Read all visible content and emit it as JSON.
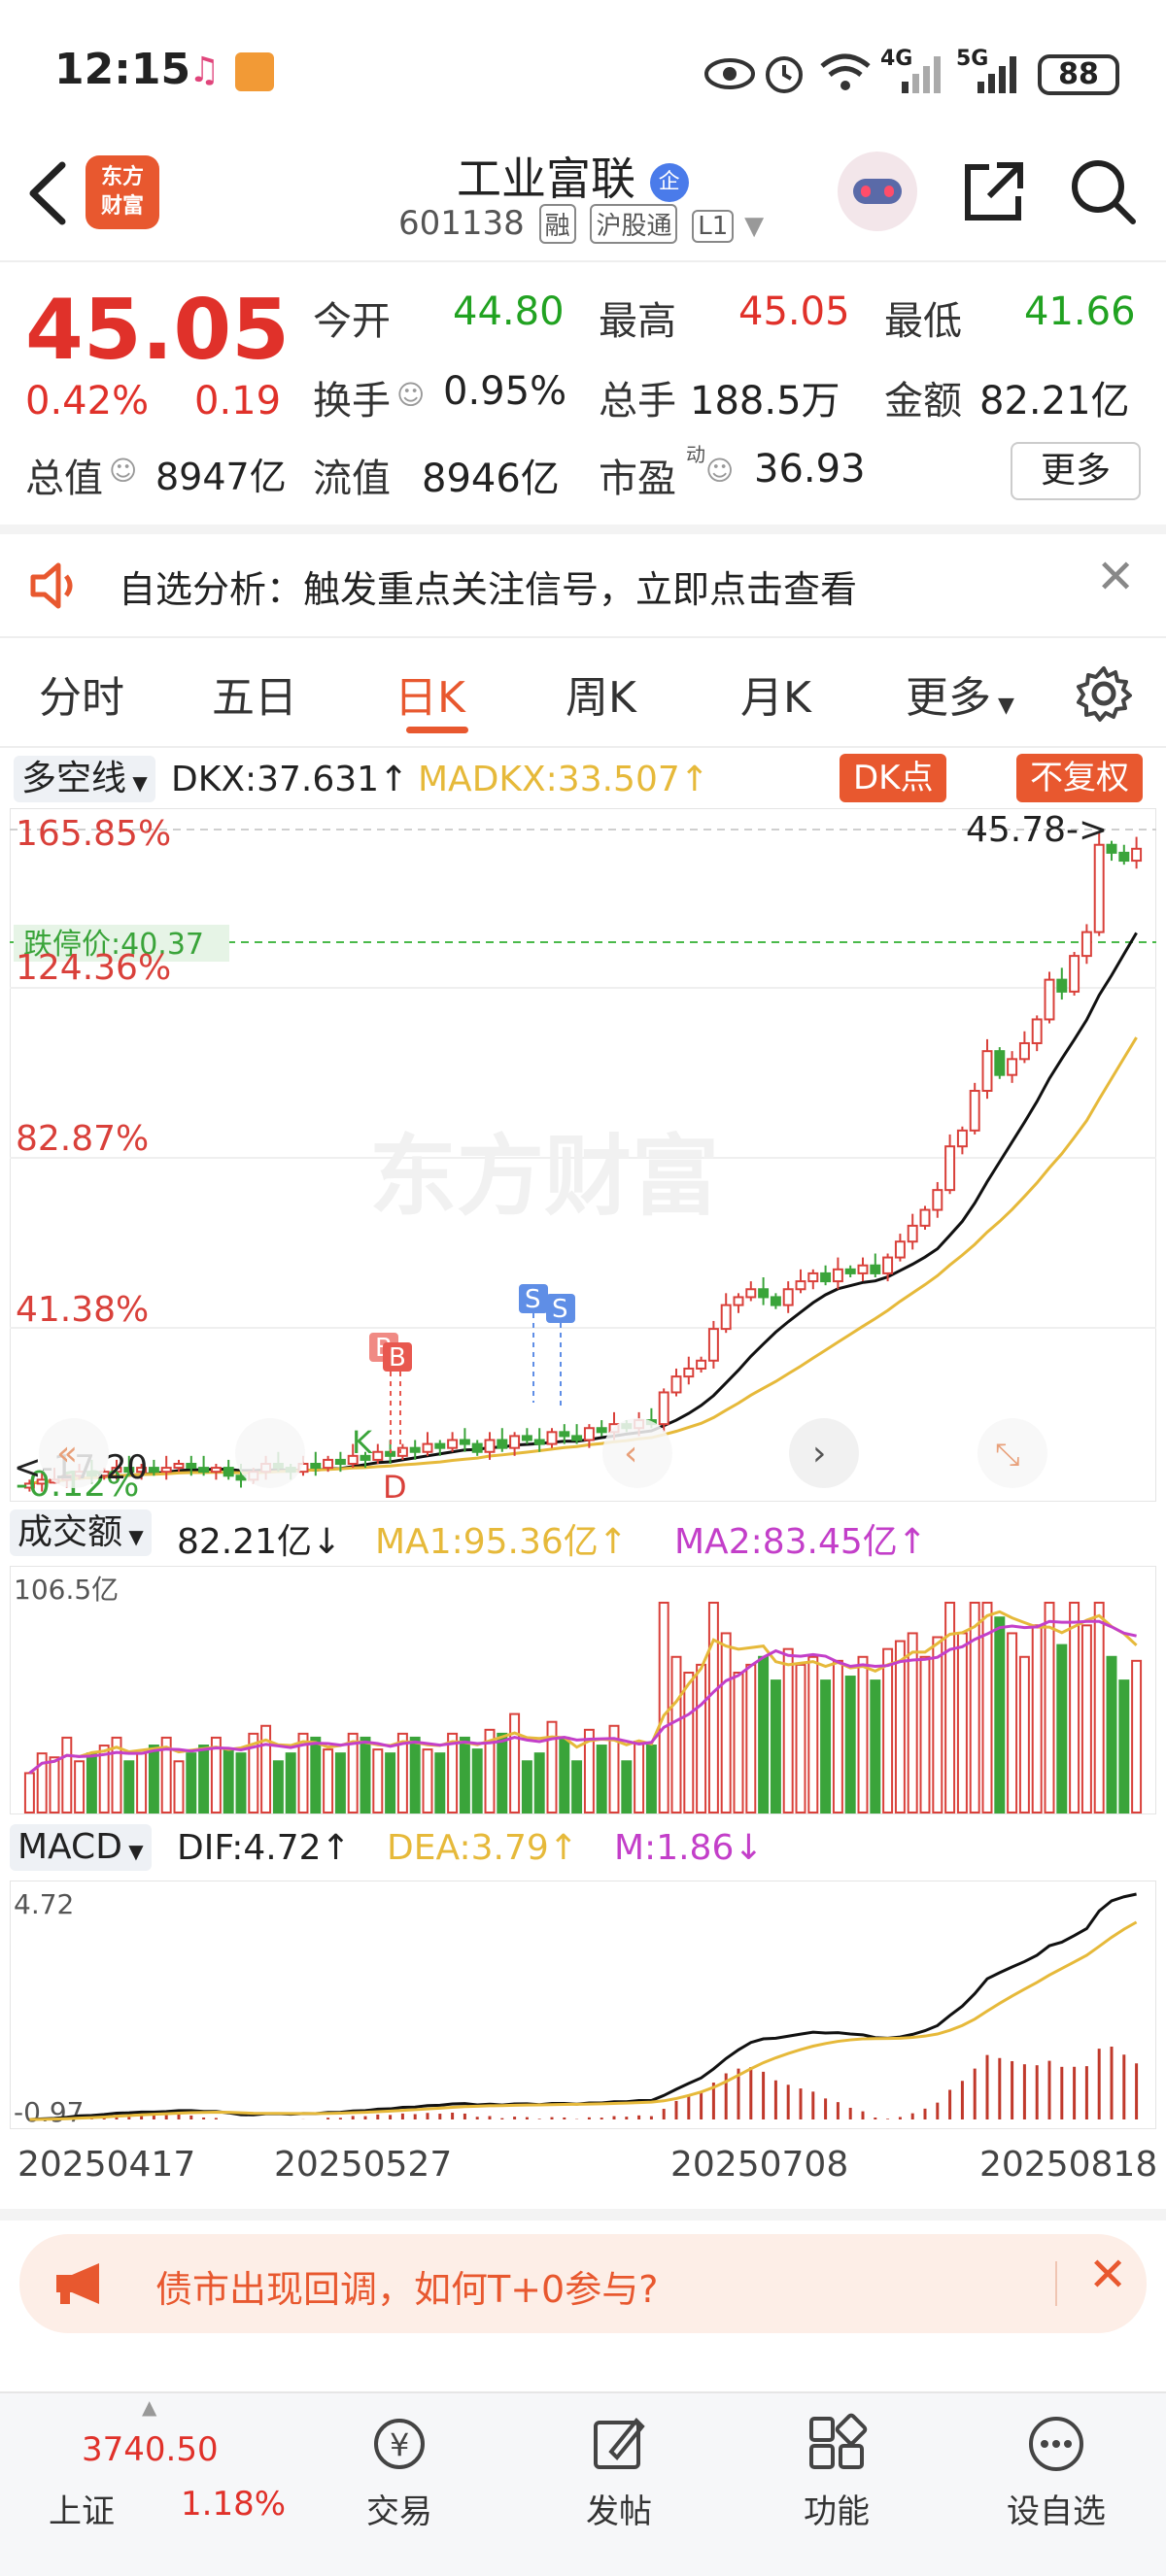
{
  "status_bar": {
    "time": "12:15",
    "battery": "88",
    "network_4g": "4G",
    "network_5g": "5G"
  },
  "header": {
    "logo_line1": "东方",
    "logo_line2": "财富",
    "stock_name": "工业富联",
    "name_badge": "企",
    "stock_code": "601138",
    "tags": [
      "融",
      "沪股通",
      "L1"
    ]
  },
  "quote": {
    "price": "45.05",
    "change_pct": "0.42%",
    "change_amt": "0.19",
    "open_label": "今开",
    "open": "44.80",
    "high_label": "最高",
    "high": "45.05",
    "low_label": "最低",
    "low": "41.66",
    "turnover_label": "换手",
    "turnover": "0.95%",
    "volume_label": "总手",
    "volume": "188.5万",
    "amount_label": "金额",
    "amount": "82.21亿",
    "mktcap_label": "总值",
    "mktcap": "8947亿",
    "float_label": "流值",
    "float_cap": "8946亿",
    "pe_label": "市盈",
    "pe_sup": "动",
    "pe": "36.93",
    "more_label": "更多"
  },
  "alert": {
    "text": "自选分析：触发重点关注信号，立即点击查看"
  },
  "tabs": [
    "分时",
    "五日",
    "日K",
    "周K",
    "月K",
    "更多"
  ],
  "active_tab": "日K",
  "kline": {
    "selector": "多空线",
    "dkx_label": "DKX:37.631",
    "madkx_label": "MADKX:33.507",
    "dk_button": "DK点",
    "adjust_button": "不复权",
    "y_labels": [
      "165.85%",
      "124.36%",
      "82.87%",
      "41.38%",
      "-0.12%"
    ],
    "limit_down_label": "跌停价:40.37",
    "max_marker": "45.78->",
    "min_marker": "<-17.20",
    "watermark": "东方财富",
    "signal_labels": [
      "B",
      "B",
      "S",
      "S",
      "K",
      "D"
    ]
  },
  "volume": {
    "selector": "成交额",
    "value": "82.21亿",
    "ma1": "MA1:95.36亿",
    "ma2": "MA2:83.45亿",
    "max_label": "106.5亿"
  },
  "macd": {
    "selector": "MACD",
    "dif": "DIF:4.72",
    "dea": "DEA:3.79",
    "m": "M:1.86",
    "top_label": "4.72",
    "bottom_label": "-0.97"
  },
  "dates": [
    "20250417",
    "20250527",
    "20250708",
    "20250818"
  ],
  "promo": {
    "text": "债市出现回调，如何T+0参与?"
  },
  "bottom_nav": {
    "index_value": "3740.50",
    "index_name": "上证",
    "index_change": "1.18%",
    "items": [
      "交易",
      "发帖",
      "功能",
      "设自选"
    ]
  },
  "chart_data": {
    "type": "candlestick",
    "y_axis_unit": "percent",
    "ylim": [
      -0.12,
      165.85
    ],
    "price_range": [
      17.2,
      45.78
    ],
    "closes_pct": [
      1,
      2,
      2,
      3,
      4,
      3,
      4,
      5,
      4,
      5,
      4,
      5,
      6,
      5,
      4,
      5,
      3,
      2,
      4,
      6,
      5,
      4,
      6,
      5,
      7,
      6,
      8,
      7,
      9,
      8,
      10,
      9,
      11,
      10,
      12,
      11,
      9,
      12,
      10,
      13,
      12,
      11,
      14,
      13,
      12,
      15,
      14,
      16,
      15,
      17,
      16,
      24,
      28,
      30,
      32,
      40,
      46,
      48,
      50,
      48,
      46,
      50,
      52,
      54,
      52,
      55,
      54,
      56,
      54,
      58,
      62,
      66,
      70,
      75,
      86,
      90,
      100,
      110,
      104,
      108,
      112,
      118,
      128,
      125,
      134,
      140,
      162,
      160,
      158,
      161
    ]
  }
}
